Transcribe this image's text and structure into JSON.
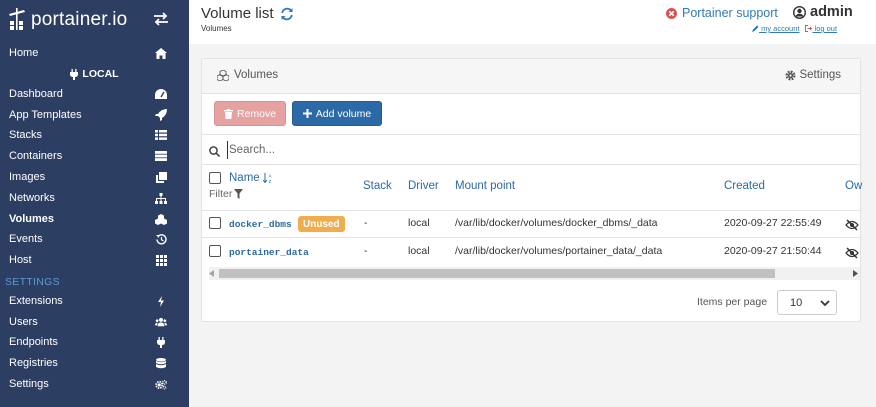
{
  "brand": {
    "name": "portainer.io"
  },
  "sidebar": {
    "home": "Home",
    "endpoint_heading": "LOCAL",
    "items": [
      {
        "label": "Dashboard",
        "icon": "tachometer-icon"
      },
      {
        "label": "App Templates",
        "icon": "rocket-icon"
      },
      {
        "label": "Stacks",
        "icon": "th-list-icon"
      },
      {
        "label": "Containers",
        "icon": "server-icon"
      },
      {
        "label": "Images",
        "icon": "clone-icon"
      },
      {
        "label": "Networks",
        "icon": "sitemap-icon"
      },
      {
        "label": "Volumes",
        "icon": "cubes-icon"
      },
      {
        "label": "Events",
        "icon": "history-icon"
      },
      {
        "label": "Host",
        "icon": "th-icon"
      }
    ],
    "settings_heading": "SETTINGS",
    "settings_items": [
      {
        "label": "Extensions",
        "icon": "bolt-icon"
      },
      {
        "label": "Users",
        "icon": "users-icon"
      },
      {
        "label": "Endpoints",
        "icon": "plug-icon"
      },
      {
        "label": "Registries",
        "icon": "database-icon"
      },
      {
        "label": "Settings",
        "icon": "cogs-icon"
      }
    ]
  },
  "header": {
    "title": "Volume list",
    "subtitle": "Volumes",
    "support": "Portainer support",
    "username": "admin",
    "my_account": "my account",
    "log_out": "log out"
  },
  "panel": {
    "title": "Volumes",
    "settings": "Settings",
    "remove": "Remove",
    "add_volume": "Add volume",
    "search_placeholder": "Search...",
    "columns": {
      "name": "Name",
      "filter": "Filter",
      "stack": "Stack",
      "driver": "Driver",
      "mount_point": "Mount point",
      "created": "Created",
      "ownership": "Ow"
    },
    "rows": [
      {
        "name": "docker_dbms",
        "badge": "Unused",
        "stack": "-",
        "driver": "local",
        "mount_point": "/var/lib/docker/volumes/docker_dbms/_data",
        "created": "2020-09-27 22:55:49"
      },
      {
        "name": "portainer_data",
        "badge": "",
        "stack": "-",
        "driver": "local",
        "mount_point": "/var/lib/docker/volumes/portainer_data/_data",
        "created": "2020-09-27 21:50:44"
      }
    ],
    "items_per_page_label": "Items per page",
    "items_per_page_value": "10"
  },
  "colors": {
    "sidebar_bg": "#2d3e63",
    "link_blue": "#337ab7",
    "remove_btn": "#e6a2a1",
    "add_btn": "#2b6aa6",
    "badge_warning": "#f0ad4e"
  }
}
